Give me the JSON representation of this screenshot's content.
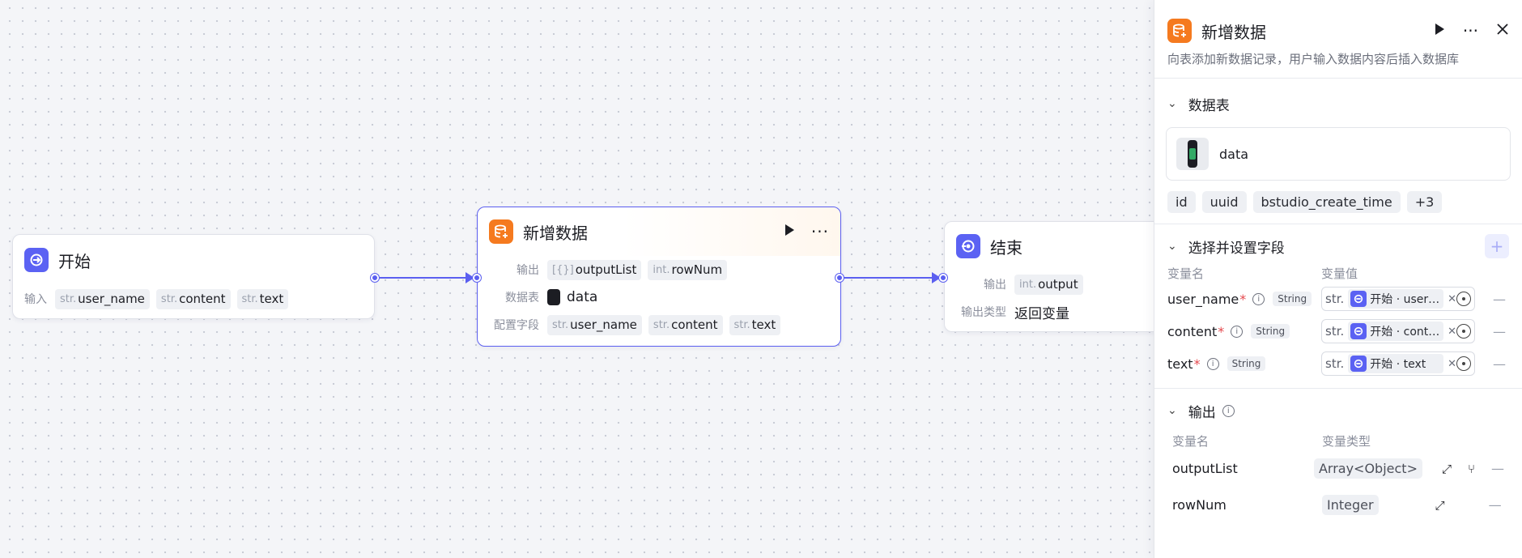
{
  "canvas": {
    "start_node": {
      "title": "开始",
      "input_label": "输入",
      "inputs": [
        {
          "type": "str.",
          "name": "user_name"
        },
        {
          "type": "str.",
          "name": "content"
        },
        {
          "type": "str.",
          "name": "text"
        }
      ]
    },
    "add_node": {
      "title": "新增数据",
      "output_label": "输出",
      "outputs": [
        {
          "type": "[{}]",
          "name": "outputList"
        },
        {
          "type": "int.",
          "name": "rowNum"
        }
      ],
      "table_label": "数据表",
      "table_value": "data",
      "fields_label": "配置字段",
      "fields": [
        {
          "type": "str.",
          "name": "user_name"
        },
        {
          "type": "str.",
          "name": "content"
        },
        {
          "type": "str.",
          "name": "text"
        }
      ]
    },
    "end_node": {
      "title": "结束",
      "output_label": "输出",
      "output": {
        "type": "int.",
        "name": "output"
      },
      "output_type_label": "输出类型",
      "output_type_value": "返回变量"
    }
  },
  "panel": {
    "title": "新增数据",
    "description": "向表添加新数据记录，用户输入数据内容后插入数据库",
    "table_section": "数据表",
    "table_name": "data",
    "columns": [
      "id",
      "uuid",
      "bstudio_create_time",
      "+3"
    ],
    "fields_section": "选择并设置字段",
    "col_var_name": "变量名",
    "col_var_value": "变量值",
    "fields": [
      {
        "name": "user_name",
        "req": "*",
        "type": "String",
        "vtype": "str.",
        "ref": "开始 · user_name"
      },
      {
        "name": "content",
        "req": "*",
        "type": "String",
        "vtype": "str.",
        "ref": "开始 · content"
      },
      {
        "name": "text",
        "req": "*",
        "type": "String",
        "vtype": "str.",
        "ref": "开始 · text"
      }
    ],
    "output_section": "输出",
    "col_out_name": "变量名",
    "col_out_type": "变量类型",
    "outputs": [
      {
        "name": "outputList",
        "type": "Array<Object>"
      },
      {
        "name": "rowNum",
        "type": "Integer"
      }
    ]
  },
  "colors": {
    "accent": "#5b5ff0",
    "start_icon": "#5b62f3",
    "db_icon": "#f57a1f"
  },
  "icons": [
    "start-icon",
    "database-add-icon",
    "end-icon",
    "play-icon",
    "more-icon",
    "close-icon",
    "chevron-down-icon",
    "info-icon",
    "target-icon",
    "expand-icon",
    "branch-icon",
    "minus-icon",
    "plus-icon"
  ]
}
